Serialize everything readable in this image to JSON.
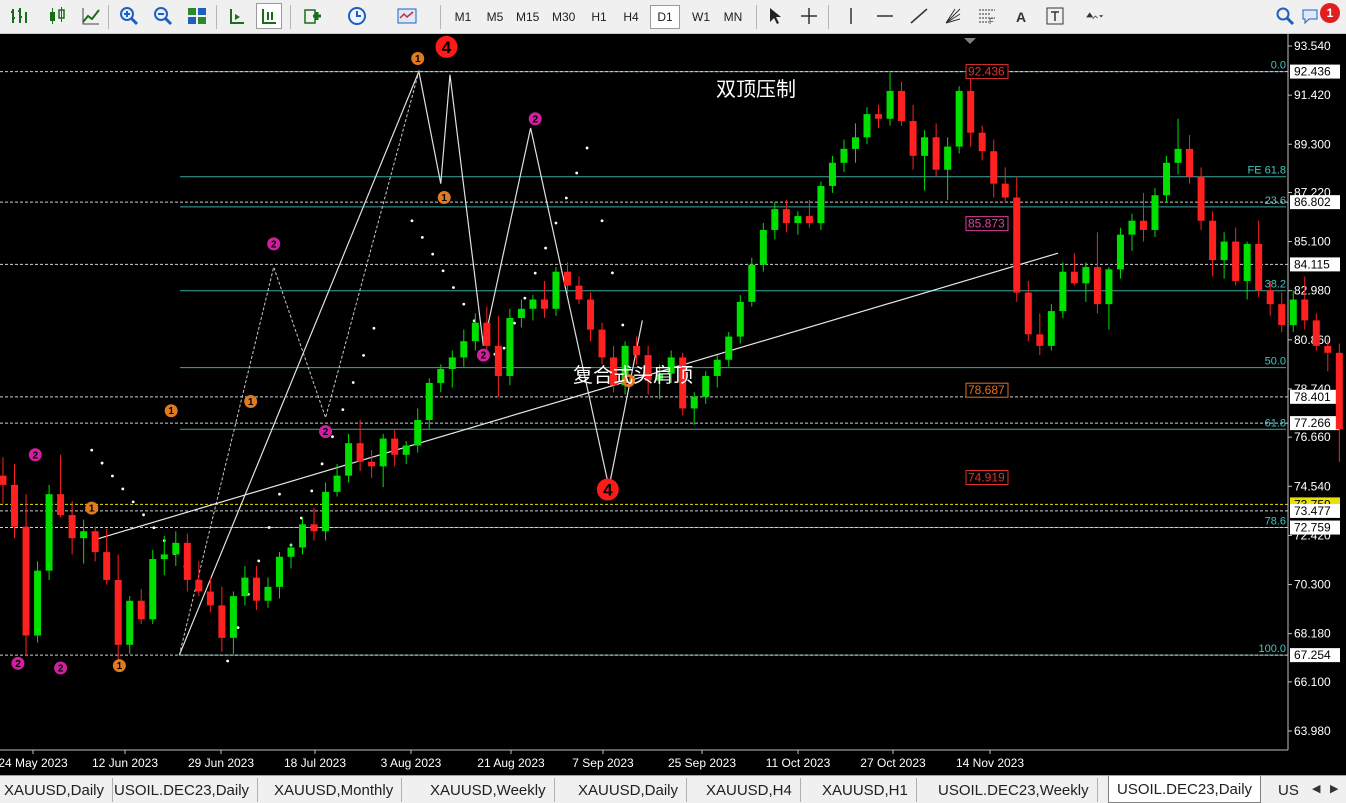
{
  "toolbar": {
    "timeframes": [
      "M1",
      "M5",
      "M15",
      "M30",
      "H1",
      "H4",
      "D1",
      "W1",
      "MN"
    ],
    "active_timeframe": "D1",
    "text_tool_label": "A",
    "notification_count": "1"
  },
  "chart": {
    "symbol": "USOIL.DEC23",
    "period": "Daily",
    "price_levels": [
      "93.540",
      "91.420",
      "89.300",
      "87.220",
      "85.100",
      "82.980",
      "80.860",
      "78.740",
      "76.660",
      "74.540",
      "72.420",
      "70.300",
      "68.180",
      "66.100",
      "63.980"
    ],
    "highlight_prices": [
      {
        "label": "92.436",
        "price": 92.436
      },
      {
        "label": "86.802",
        "price": 86.802
      },
      {
        "label": "84.115",
        "price": 84.115
      },
      {
        "label": "78.401",
        "price": 78.401
      },
      {
        "label": "77.266",
        "price": 77.266
      },
      {
        "label": "73.759",
        "price": 73.759,
        "color": "#e8e000"
      },
      {
        "label": "73.477",
        "price": 73.477
      },
      {
        "label": "72.759",
        "price": 72.759
      },
      {
        "label": "67.254",
        "price": 67.254
      }
    ],
    "dates": [
      "24 May 2023",
      "12 Jun 2023",
      "29 Jun 2023",
      "18 Jul 2023",
      "3 Aug 2023",
      "21 Aug 2023",
      "7 Sep 2023",
      "25 Sep 2023",
      "11 Oct 2023",
      "27 Oct 2023",
      "14 Nov 2023"
    ],
    "fib_levels": [
      {
        "label": "0.0",
        "price": 92.436
      },
      {
        "label": "FE 61.8",
        "price": 87.9
      },
      {
        "label": "23.6",
        "price": 86.6
      },
      {
        "label": "38.2",
        "price": 82.98
      },
      {
        "label": "50.0",
        "price": 79.66
      },
      {
        "label": "61.8",
        "price": 77.0
      },
      {
        "label": "78.6",
        "price": 72.759
      },
      {
        "label": "100.0",
        "price": 67.254
      }
    ],
    "price_boxes": [
      {
        "label": "92.436",
        "price": 92.436,
        "color": "#e03030"
      },
      {
        "label": "85.873",
        "price": 85.873,
        "color": "#e040a0"
      },
      {
        "label": "78.687",
        "price": 78.687,
        "color": "#e07020"
      },
      {
        "label": "74.919",
        "price": 74.919,
        "color": "#e03030"
      }
    ],
    "annotations": {
      "double_top": "双顶压制",
      "head_shoulders": "复合式头肩顶"
    },
    "wave_markers": [
      {
        "label": "4",
        "t": 38.5,
        "p": 93.5,
        "kind": "big"
      },
      {
        "label": "4",
        "t": 52.5,
        "p": 74.4,
        "kind": "big"
      },
      {
        "label": "1",
        "t": 36,
        "p": 93.0,
        "kind": "orange"
      },
      {
        "label": "1",
        "t": 38.3,
        "p": 87.0,
        "kind": "orange"
      },
      {
        "label": "1",
        "t": 14.6,
        "p": 77.8,
        "kind": "orange"
      },
      {
        "label": "1",
        "t": 21.5,
        "p": 78.2,
        "kind": "orange"
      },
      {
        "label": "1",
        "t": 7.7,
        "p": 73.6,
        "kind": "orange"
      },
      {
        "label": "1",
        "t": 10.1,
        "p": 66.8,
        "kind": "orange"
      },
      {
        "label": "1",
        "t": 54.3,
        "p": 79.1,
        "kind": "orange"
      },
      {
        "label": "2",
        "t": 23.5,
        "p": 85.0,
        "kind": "magenta"
      },
      {
        "label": "2",
        "t": 28.0,
        "p": 76.9,
        "kind": "magenta"
      },
      {
        "label": "2",
        "t": 41.7,
        "p": 80.2,
        "kind": "magenta"
      },
      {
        "label": "2",
        "t": 46.2,
        "p": 90.4,
        "kind": "magenta"
      },
      {
        "label": "2",
        "t": 2.8,
        "p": 75.9,
        "kind": "magenta"
      },
      {
        "label": "2",
        "t": 1.3,
        "p": 66.9,
        "kind": "magenta"
      },
      {
        "label": "2",
        "t": 5.0,
        "p": 66.7,
        "kind": "magenta"
      }
    ],
    "candles": [
      [
        75.0,
        75.8,
        73.8,
        74.6
      ],
      [
        74.6,
        75.5,
        72.3,
        72.8
      ],
      [
        72.8,
        74.2,
        67.2,
        68.1
      ],
      [
        68.1,
        71.3,
        67.8,
        70.9
      ],
      [
        70.9,
        74.6,
        70.5,
        74.2
      ],
      [
        74.2,
        75.9,
        73.2,
        73.3
      ],
      [
        73.3,
        73.9,
        71.6,
        72.3
      ],
      [
        72.3,
        73.1,
        71.2,
        72.6
      ],
      [
        72.6,
        72.8,
        71.3,
        71.7
      ],
      [
        71.7,
        72.7,
        70.3,
        70.5
      ],
      [
        70.5,
        71.6,
        67.0,
        67.7
      ],
      [
        67.7,
        69.8,
        67.3,
        69.6
      ],
      [
        69.6,
        70.1,
        68.6,
        68.8
      ],
      [
        68.8,
        71.8,
        68.6,
        71.4
      ],
      [
        71.4,
        72.4,
        70.7,
        71.6
      ],
      [
        71.6,
        72.6,
        71.1,
        72.1
      ],
      [
        72.1,
        72.5,
        70.0,
        70.5
      ],
      [
        70.5,
        71.3,
        69.8,
        70.0
      ],
      [
        70.0,
        70.6,
        69.1,
        69.4
      ],
      [
        69.4,
        70.2,
        67.4,
        68.0
      ],
      [
        68.0,
        70.0,
        67.3,
        69.8
      ],
      [
        69.8,
        71.1,
        69.4,
        70.6
      ],
      [
        70.6,
        71.1,
        69.2,
        69.6
      ],
      [
        69.6,
        70.6,
        69.3,
        70.2
      ],
      [
        70.2,
        71.7,
        69.7,
        71.5
      ],
      [
        71.5,
        72.1,
        71.0,
        71.9
      ],
      [
        71.9,
        73.2,
        71.6,
        72.9
      ],
      [
        72.9,
        73.6,
        72.2,
        72.6
      ],
      [
        72.6,
        74.7,
        72.2,
        74.3
      ],
      [
        74.3,
        75.5,
        74.1,
        75.0
      ],
      [
        75.0,
        76.8,
        74.7,
        76.4
      ],
      [
        76.4,
        77.4,
        75.2,
        75.6
      ],
      [
        75.6,
        76.1,
        74.9,
        75.4
      ],
      [
        75.4,
        76.8,
        74.5,
        76.6
      ],
      [
        76.6,
        77.0,
        75.4,
        75.9
      ],
      [
        75.9,
        76.5,
        75.5,
        76.3
      ],
      [
        76.3,
        77.9,
        76.0,
        77.4
      ],
      [
        77.4,
        79.2,
        77.0,
        79.0
      ],
      [
        79.0,
        79.8,
        78.6,
        79.6
      ],
      [
        79.6,
        80.4,
        78.8,
        80.1
      ],
      [
        80.1,
        81.3,
        79.7,
        80.8
      ],
      [
        80.8,
        82.0,
        80.4,
        81.6
      ],
      [
        81.6,
        82.3,
        80.2,
        80.6
      ],
      [
        80.6,
        81.9,
        78.4,
        79.3
      ],
      [
        79.3,
        82.2,
        78.9,
        81.8
      ],
      [
        81.8,
        82.6,
        81.4,
        82.2
      ],
      [
        82.2,
        82.8,
        81.7,
        82.6
      ],
      [
        82.6,
        83.4,
        81.8,
        82.2
      ],
      [
        82.2,
        84.0,
        81.9,
        83.8
      ],
      [
        83.8,
        84.2,
        82.8,
        83.2
      ],
      [
        83.2,
        83.6,
        82.4,
        82.6
      ],
      [
        82.6,
        82.9,
        80.8,
        81.3
      ],
      [
        81.3,
        81.6,
        79.8,
        80.1
      ],
      [
        80.1,
        80.6,
        78.6,
        78.9
      ],
      [
        78.9,
        80.8,
        78.5,
        80.6
      ],
      [
        80.6,
        81.0,
        79.8,
        80.2
      ],
      [
        80.2,
        80.6,
        78.5,
        79.1
      ],
      [
        79.1,
        79.8,
        78.3,
        79.4
      ],
      [
        79.4,
        80.4,
        79.0,
        80.1
      ],
      [
        80.1,
        80.3,
        77.6,
        77.9
      ],
      [
        77.9,
        78.6,
        77.2,
        78.4
      ],
      [
        78.4,
        79.5,
        78.1,
        79.3
      ],
      [
        79.3,
        80.2,
        78.8,
        80.0
      ],
      [
        80.0,
        81.2,
        79.7,
        81.0
      ],
      [
        81.0,
        82.8,
        80.7,
        82.5
      ],
      [
        82.5,
        84.4,
        82.3,
        84.1
      ],
      [
        84.1,
        85.9,
        83.8,
        85.6
      ],
      [
        85.6,
        86.8,
        85.2,
        86.5
      ],
      [
        86.5,
        86.9,
        85.5,
        85.9
      ],
      [
        85.9,
        86.4,
        85.4,
        86.2
      ],
      [
        86.2,
        86.9,
        85.7,
        85.9
      ],
      [
        85.9,
        87.7,
        85.6,
        87.5
      ],
      [
        87.5,
        88.8,
        87.2,
        88.5
      ],
      [
        88.5,
        89.5,
        88.1,
        89.1
      ],
      [
        89.1,
        90.2,
        88.5,
        89.6
      ],
      [
        89.6,
        90.9,
        89.3,
        90.6
      ],
      [
        90.6,
        91.0,
        90.0,
        90.4
      ],
      [
        90.4,
        92.4,
        90.1,
        91.6
      ],
      [
        91.6,
        92.0,
        90.1,
        90.3
      ],
      [
        90.3,
        91.0,
        88.2,
        88.8
      ],
      [
        88.8,
        89.9,
        87.3,
        89.6
      ],
      [
        89.6,
        90.2,
        87.9,
        88.2
      ],
      [
        88.2,
        89.6,
        86.9,
        89.2
      ],
      [
        89.2,
        91.8,
        88.9,
        91.6
      ],
      [
        91.6,
        92.5,
        89.2,
        89.8
      ],
      [
        89.8,
        90.1,
        88.6,
        89.0
      ],
      [
        89.0,
        89.5,
        87.0,
        87.6
      ],
      [
        87.6,
        88.3,
        86.8,
        87.0
      ],
      [
        87.0,
        87.9,
        82.5,
        82.9
      ],
      [
        82.9,
        83.4,
        80.8,
        81.1
      ],
      [
        81.1,
        82.0,
        80.2,
        80.6
      ],
      [
        80.6,
        82.4,
        80.4,
        82.1
      ],
      [
        82.1,
        84.2,
        81.8,
        83.8
      ],
      [
        83.8,
        84.6,
        83.2,
        83.3
      ],
      [
        83.3,
        84.2,
        82.5,
        84.0
      ],
      [
        84.0,
        85.5,
        82.0,
        82.4
      ],
      [
        82.4,
        84.0,
        81.3,
        83.9
      ],
      [
        83.9,
        85.7,
        83.5,
        85.4
      ],
      [
        85.4,
        86.3,
        84.7,
        86.0
      ],
      [
        86.0,
        87.2,
        85.1,
        85.6
      ],
      [
        85.6,
        87.4,
        85.3,
        87.1
      ],
      [
        87.1,
        88.8,
        86.8,
        88.5
      ],
      [
        88.5,
        90.4,
        88.0,
        89.1
      ],
      [
        89.1,
        89.7,
        87.6,
        87.9
      ],
      [
        87.9,
        88.3,
        85.6,
        86.0
      ],
      [
        86.0,
        86.4,
        83.6,
        84.3
      ],
      [
        84.3,
        85.5,
        83.5,
        85.1
      ],
      [
        85.1,
        85.7,
        83.2,
        83.4
      ],
      [
        83.4,
        85.1,
        82.6,
        85.0
      ],
      [
        85.0,
        86.0,
        82.7,
        83.0
      ],
      [
        83.0,
        83.4,
        81.9,
        82.4
      ],
      [
        82.4,
        82.9,
        81.2,
        81.5
      ],
      [
        81.5,
        83.0,
        81.2,
        82.6
      ],
      [
        82.6,
        83.6,
        81.3,
        81.7
      ],
      [
        81.7,
        82.0,
        80.4,
        80.6
      ],
      [
        80.6,
        80.9,
        79.5,
        80.3
      ],
      [
        80.3,
        80.7,
        75.6,
        77.0
      ],
      [
        77.0,
        77.2,
        75.0,
        75.4
      ],
      [
        75.4,
        77.3,
        74.9,
        76.9
      ],
      [
        76.9,
        77.1,
        75.2,
        75.6
      ],
      [
        75.6,
        78.3,
        75.4,
        78.0
      ],
      [
        78.0,
        78.9,
        77.6,
        78.4
      ]
    ]
  }
}
